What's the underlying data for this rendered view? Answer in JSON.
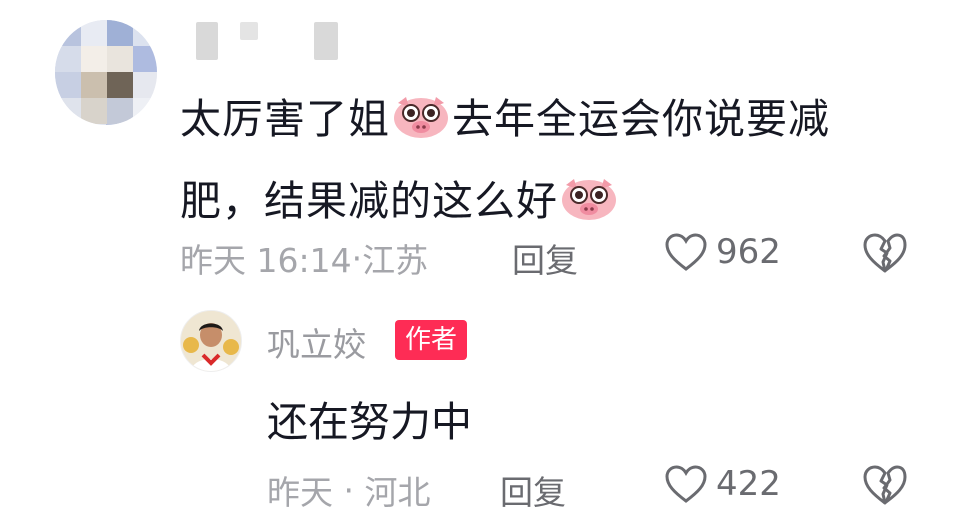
{
  "comment": {
    "text_part1": "太厉害了姐",
    "text_part2": "去年全运会你说要减肥，结果减的这么好",
    "emoji": "pig-face-emoji",
    "time": "昨天 16:14",
    "location": "江苏",
    "reply_label": "回复",
    "like_count": "962"
  },
  "reply": {
    "author_name": "巩立姣",
    "author_badge": "作者",
    "text": "还在努力中",
    "time": "昨天",
    "location": "河北",
    "reply_label": "回复",
    "like_count": "422"
  },
  "colors": {
    "badge": "#fe2c55",
    "meta_text": "#a5a6ab",
    "main_text": "#161823"
  }
}
